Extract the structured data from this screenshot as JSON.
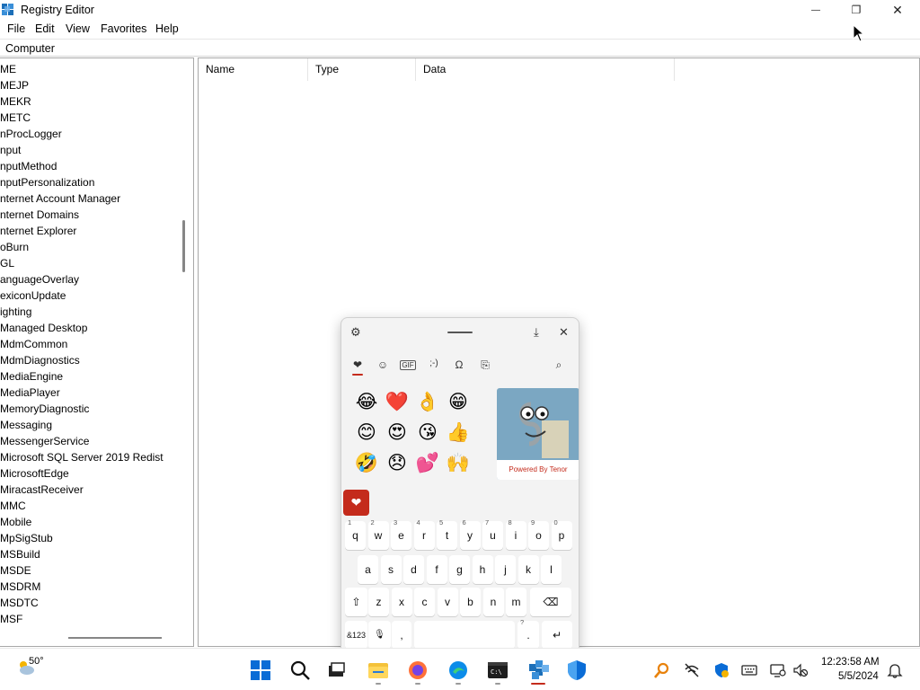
{
  "window": {
    "title": "Registry Editor",
    "minimize_glyph": "—",
    "maximize_glyph": "❐",
    "close_glyph": "✕"
  },
  "menu": {
    "file": "File",
    "edit": "Edit",
    "view": "View",
    "favorites": "Favorites",
    "help": "Help"
  },
  "address": {
    "path": "Computer"
  },
  "tree": {
    "items": [
      "ME",
      "MEJP",
      "MEKR",
      "METC",
      "nProcLogger",
      "nput",
      "nputMethod",
      "nputPersonalization",
      "nternet Account Manager",
      "nternet Domains",
      "nternet Explorer",
      "oBurn",
      "GL",
      "anguageOverlay",
      "exiconUpdate",
      "ighting",
      "Managed Desktop",
      "MdmCommon",
      "MdmDiagnostics",
      "MediaEngine",
      "MediaPlayer",
      "MemoryDiagnostic",
      "Messaging",
      "MessengerService",
      "Microsoft SQL Server 2019 Redist",
      "MicrosoftEdge",
      "MiracastReceiver",
      "MMC",
      "Mobile",
      "MpSigStub",
      "MSBuild",
      "MSDE",
      "MSDRM",
      "MSDTC",
      "MSF"
    ]
  },
  "list": {
    "columns": [
      "Name",
      "Type",
      "Data"
    ]
  },
  "emoji_panel": {
    "settings_icon": "⚙",
    "pin_icon": "⤓",
    "close_icon": "✕",
    "tabs": [
      "❤",
      "☺",
      "GIF",
      ";-)",
      "Ω",
      "⎘"
    ],
    "search_icon": "⌕",
    "emojis": [
      "😂",
      "❤️",
      "👌",
      "😁",
      "😊",
      "😍",
      "😘",
      "👍",
      "🤣",
      "😞",
      "💕",
      "🙌"
    ],
    "gif_caption": "Powered By Tenor",
    "sticker_glyph": "❤"
  },
  "keyboard": {
    "row1": [
      "q",
      "w",
      "e",
      "r",
      "t",
      "y",
      "u",
      "i",
      "o",
      "p"
    ],
    "row1_hints": [
      "1",
      "2",
      "3",
      "4",
      "5",
      "6",
      "7",
      "8",
      "9",
      "0"
    ],
    "row2": [
      "a",
      "s",
      "d",
      "f",
      "g",
      "h",
      "j",
      "k",
      "l"
    ],
    "row3": [
      "z",
      "x",
      "c",
      "v",
      "b",
      "n",
      "m"
    ],
    "shift": "⇧",
    "backspace": "⌫",
    "symbols": "&123",
    "mic": "🎙",
    "comma": ",",
    "period": ".",
    "period_hint": "?",
    "enter": "↵"
  },
  "taskbar": {
    "weather_temp": "50°",
    "clock_time": "12:23:58 AM",
    "clock_date": "5/5/2024"
  }
}
